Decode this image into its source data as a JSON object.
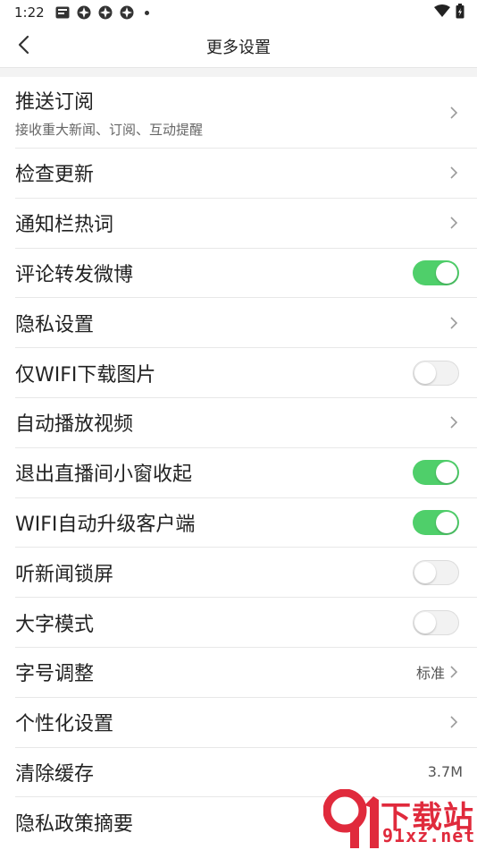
{
  "status_bar": {
    "time": "1:22",
    "icons": [
      "notification-app-icon",
      "notification-spin-icon",
      "notification-spin-icon",
      "notification-spin-icon",
      "more-dot-icon"
    ],
    "right_icons": [
      "wifi-icon",
      "battery-icon"
    ]
  },
  "nav": {
    "title": "更多设置",
    "back_icon": "chevron-left-icon"
  },
  "settings": {
    "push": {
      "label": "推送订阅",
      "sub": "接收重大新闻、订阅、互动提醒"
    },
    "check_update": {
      "label": "检查更新"
    },
    "notif_hot": {
      "label": "通知栏热词"
    },
    "comment_weibo": {
      "label": "评论转发微博",
      "enabled": true
    },
    "privacy": {
      "label": "隐私设置"
    },
    "wifi_images": {
      "label": "仅WIFI下载图片",
      "enabled": false
    },
    "autoplay": {
      "label": "自动播放视频"
    },
    "live_window": {
      "label": "退出直播间小窗收起",
      "enabled": true
    },
    "wifi_upgrade": {
      "label": "WIFI自动升级客户端",
      "enabled": true
    },
    "lock_screen": {
      "label": "听新闻锁屏",
      "enabled": false
    },
    "big_font": {
      "label": "大字模式",
      "enabled": false
    },
    "font_size": {
      "label": "字号调整",
      "value": "标准"
    },
    "personalize": {
      "label": "个性化设置"
    },
    "clear_cache": {
      "label": "清除缓存",
      "value": "3.7M"
    },
    "privacy_summary": {
      "label": "隐私政策摘要"
    }
  },
  "colors": {
    "toggle_on": "#4fcf6a",
    "toggle_off": "#f2f2f2",
    "watermark": "#e02a3c"
  },
  "watermark": {
    "text": "下载站",
    "url": "91xz.net"
  }
}
